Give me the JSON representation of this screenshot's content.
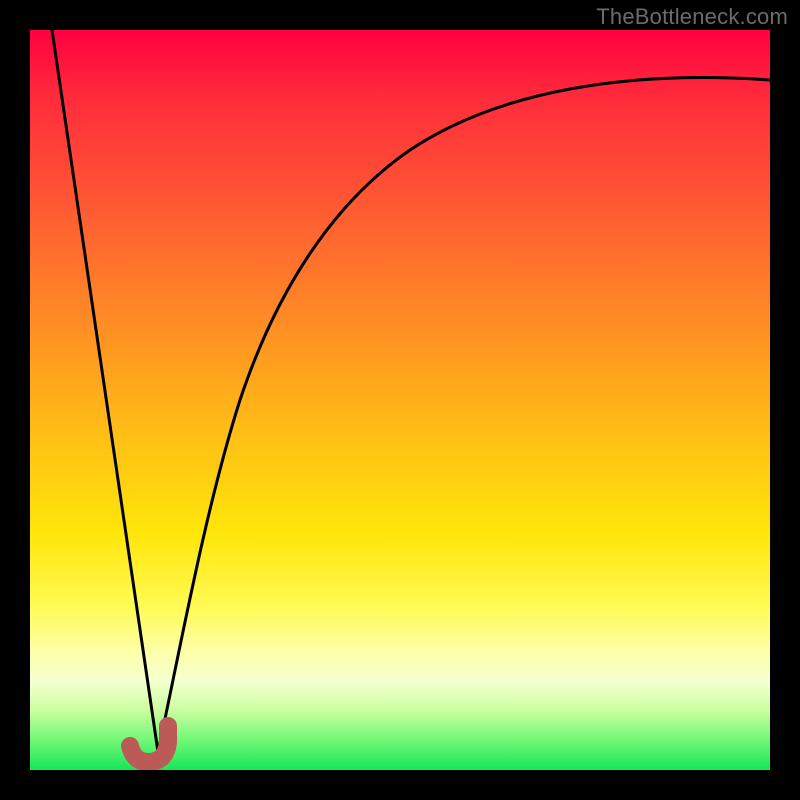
{
  "watermark": "TheBottleneck.com",
  "colors": {
    "frame": "#000000",
    "gradient_top": "#ff0040",
    "gradient_bottom": "#17e65a",
    "curve": "#000000",
    "marker": "#bb5a56"
  },
  "chart_data": {
    "type": "line",
    "title": "",
    "xlabel": "",
    "ylabel": "",
    "xlim": [
      0,
      100
    ],
    "ylim": [
      0,
      100
    ],
    "grid": false,
    "legend": false,
    "series": [
      {
        "name": "left-slope",
        "x": [
          3,
          17
        ],
        "y": [
          100,
          2
        ]
      },
      {
        "name": "right-curve",
        "x": [
          17,
          20,
          24,
          28,
          33,
          40,
          48,
          58,
          70,
          84,
          100
        ],
        "y": [
          2,
          18,
          35,
          48,
          59,
          69,
          77,
          83,
          88,
          91,
          93
        ]
      }
    ],
    "marker": {
      "name": "J",
      "color": "#bb5a56",
      "approx_center_x": 15,
      "approx_center_y": 3
    }
  }
}
